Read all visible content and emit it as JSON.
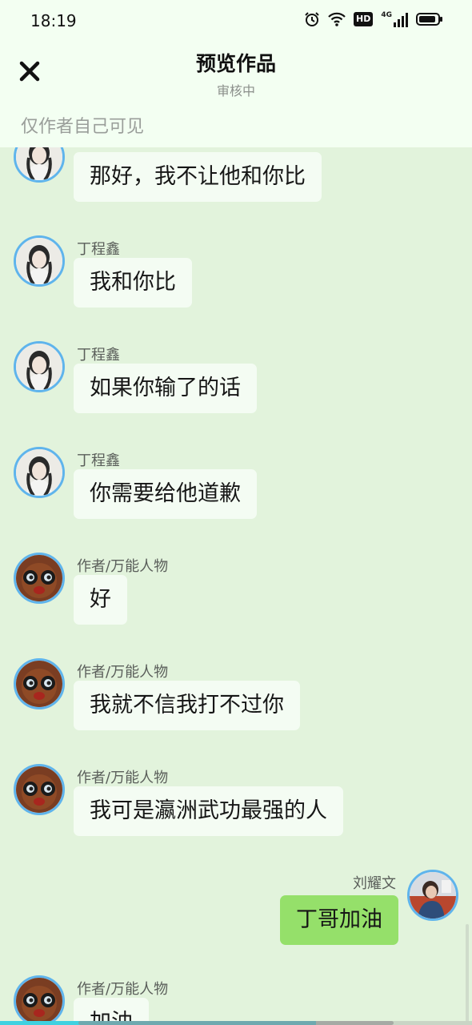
{
  "status_bar": {
    "time": "18:19",
    "icons": [
      "alarm-icon",
      "wifi-icon",
      "hd-icon",
      "4g-signal-icon",
      "battery-icon"
    ],
    "hd_label": "HD",
    "network_label": "4G"
  },
  "header": {
    "title": "预览作品",
    "subtitle": "审核中",
    "close_icon": "close-icon",
    "visibility_note": "仅作者自己可见"
  },
  "colors": {
    "background": "#e2f3dc",
    "header": "#f3fff2",
    "bubble_left": "#f4fcf3",
    "bubble_right": "#95e06a",
    "avatar_ring": "#5fb4ec"
  },
  "messages": [
    {
      "side": "left",
      "name": "",
      "text": "那好，我不让他和你比",
      "avatar": "character-a"
    },
    {
      "side": "left",
      "name": "丁程鑫",
      "text": "我和你比",
      "avatar": "character-a"
    },
    {
      "side": "left",
      "name": "丁程鑫",
      "text": "如果你输了的话",
      "avatar": "character-a"
    },
    {
      "side": "left",
      "name": "丁程鑫",
      "text": "你需要给他道歉",
      "avatar": "character-a"
    },
    {
      "side": "left",
      "name": "作者/万能人物",
      "text": "好",
      "avatar": "author"
    },
    {
      "side": "left",
      "name": "作者/万能人物",
      "text": "我就不信我打不过你",
      "avatar": "author"
    },
    {
      "side": "left",
      "name": "作者/万能人物",
      "text": "我可是瀛洲武功最强的人",
      "avatar": "author"
    },
    {
      "side": "right",
      "name": "刘耀文",
      "text": "丁哥加油",
      "avatar": "character-b"
    },
    {
      "side": "left",
      "name": "作者/万能人物",
      "text": "加油",
      "avatar": "author"
    }
  ],
  "reading_progress": 0.67
}
